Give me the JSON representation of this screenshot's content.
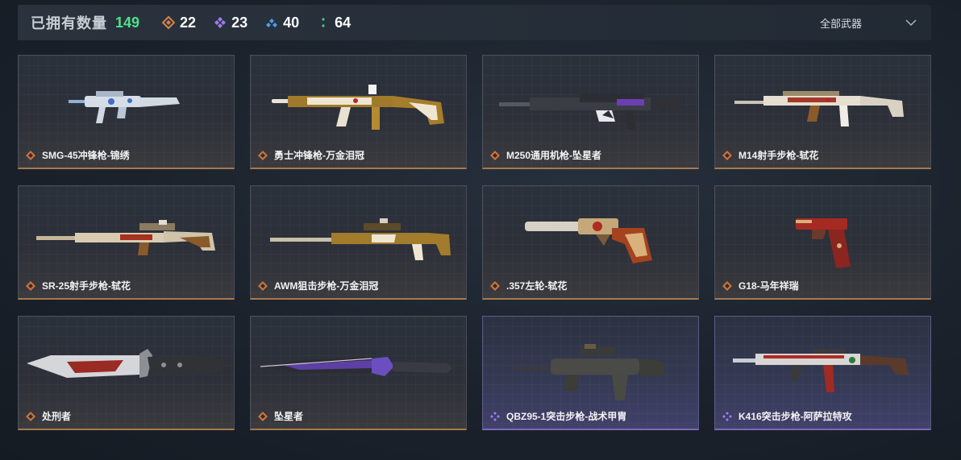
{
  "header": {
    "owned_label": "已拥有数量",
    "owned_total": "149",
    "rarity_counts": [
      {
        "icon": "orange-diamond-icon",
        "count": "22",
        "color": "#d9834a"
      },
      {
        "icon": "purple-diamond-icon",
        "count": "23",
        "color": "#9a7cf0"
      },
      {
        "icon": "blue-diamond-icon",
        "count": "40",
        "color": "#4f9be8"
      },
      {
        "icon": "green-dots-icon",
        "count": "64",
        "color": "#3fd18a"
      }
    ],
    "filter_label": "全部武器"
  },
  "weapons": [
    {
      "name": "SMG-45冲锋枪-锦绣",
      "rarity": "gold"
    },
    {
      "name": "勇士冲锋枪-万金泪冠",
      "rarity": "gold"
    },
    {
      "name": "M250通用机枪-坠星者",
      "rarity": "gold"
    },
    {
      "name": "M14射手步枪-轼花",
      "rarity": "gold"
    },
    {
      "name": "SR-25射手步枪-轼花",
      "rarity": "gold"
    },
    {
      "name": "AWM狙击步枪-万金泪冠",
      "rarity": "gold"
    },
    {
      "name": ".357左轮-轼花",
      "rarity": "gold"
    },
    {
      "name": "G18-马年祥瑞",
      "rarity": "gold"
    },
    {
      "name": "处刑者",
      "rarity": "gold"
    },
    {
      "name": "坠星者",
      "rarity": "gold"
    },
    {
      "name": "QBZ95-1突击步枪-战术甲胄",
      "rarity": "purple"
    },
    {
      "name": "K416突击步枪-阿萨拉特攻",
      "rarity": "purple"
    }
  ],
  "colors": {
    "gold_accent": "#d9834a",
    "purple_accent": "#9a7cf0",
    "total_green": "#4fe08a"
  }
}
